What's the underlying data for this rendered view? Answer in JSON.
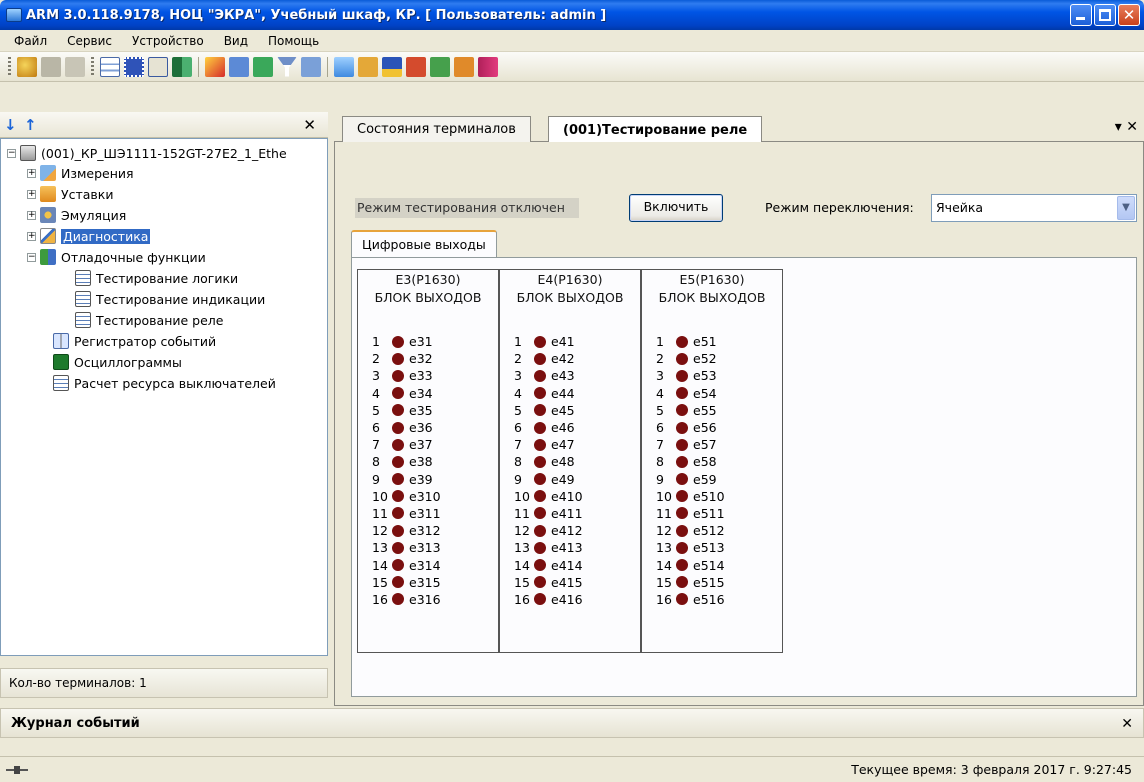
{
  "window": {
    "title": "ARM 3.0.118.9178, НОЦ \"ЭКРА\", Учебный шкаф, КР. [ Пользователь: admin ]"
  },
  "menu": [
    "Файл",
    "Сервис",
    "Устройство",
    "Вид",
    "Помощь"
  ],
  "tree": {
    "root": "(001)_КР_ШЭ1111-152GT-27E2_1_Ethe",
    "items": [
      {
        "label": "Измерения",
        "icon": "measurements-icon",
        "expander": "+"
      },
      {
        "label": "Уставки",
        "icon": "settings-folder-icon",
        "expander": "+"
      },
      {
        "label": "Эмуляция",
        "icon": "emulation-icon",
        "expander": "+"
      },
      {
        "label": "Диагностика",
        "icon": "diagnostics-icon",
        "expander": "+",
        "selected": true
      },
      {
        "label": "Отладочные функции",
        "icon": "debug-icon",
        "expander": "−"
      },
      {
        "label": "Тестирование логики",
        "icon": "test-table-icon",
        "child": true
      },
      {
        "label": "Тестирование индикации",
        "icon": "test-table-icon",
        "child": true
      },
      {
        "label": "Тестирование реле",
        "icon": "test-table-icon",
        "child": true
      },
      {
        "label": "Регистратор событий",
        "icon": "event-recorder-icon"
      },
      {
        "label": "Осциллограммы",
        "icon": "oscillogram-icon"
      },
      {
        "label": "Расчет ресурса выключателей",
        "icon": "breaker-resource-icon"
      }
    ],
    "terminals_count_label": "Кол-во терминалов: 1"
  },
  "tabs": {
    "items": [
      "Состояния терминалов",
      "(001)Тестирование реле"
    ],
    "active": 1
  },
  "testing": {
    "mode_status": "Режим тестирования отключен",
    "enable_button": "Включить",
    "switch_mode_label": "Режим переключения:",
    "switch_mode_value": "Ячейка",
    "subtab": "Цифровые выходы"
  },
  "blocks": [
    {
      "name": "Е3(Р1630)",
      "subtitle": "БЛОК ВЫХОДОВ",
      "outputs": [
        "e31",
        "e32",
        "e33",
        "e34",
        "e35",
        "e36",
        "e37",
        "e38",
        "e39",
        "e310",
        "e311",
        "e312",
        "e313",
        "e314",
        "e315",
        "e316"
      ]
    },
    {
      "name": "Е4(Р1630)",
      "subtitle": "БЛОК ВЫХОДОВ",
      "outputs": [
        "e41",
        "e42",
        "e43",
        "e44",
        "e45",
        "e46",
        "e47",
        "e48",
        "e49",
        "e410",
        "e411",
        "e412",
        "e413",
        "e414",
        "e415",
        "e416"
      ]
    },
    {
      "name": "Е5(Р1630)",
      "subtitle": "БЛОК ВЫХОДОВ",
      "outputs": [
        "e51",
        "e52",
        "e53",
        "e54",
        "e55",
        "e56",
        "e57",
        "e58",
        "e59",
        "e510",
        "e511",
        "e512",
        "e513",
        "e514",
        "e515",
        "e516"
      ]
    }
  ],
  "led_color": "#7a0f0f",
  "journal": {
    "title": "Журнал событий"
  },
  "status": {
    "time": "Текущее время: 3 февраля 2017 г. 9:27:45"
  }
}
